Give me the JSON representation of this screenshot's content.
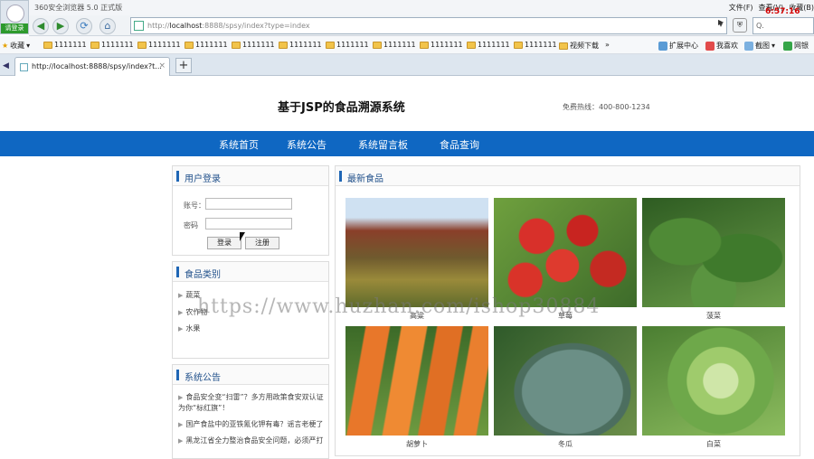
{
  "browser": {
    "window_title": "360安全浏览器 5.0 正式版",
    "menus": [
      "文件(F)",
      "查看(V)",
      "收藏(B)"
    ],
    "clock": "6:57:16",
    "avatar_label": "请登录",
    "address": {
      "prefix": "http://",
      "host": "localhost",
      "rest": ":8888/spsy/index?type=index"
    },
    "search_placeholder": "Q.",
    "bookmarks": {
      "favorites_label": "收藏",
      "folders": [
        "1111111",
        "1111111",
        "1111111",
        "1111111",
        "1111111",
        "1111111",
        "1111111",
        "1111111",
        "1111111",
        "1111111",
        "1111111",
        "1111111"
      ],
      "video_label": "视频下载",
      "more": "»",
      "extensions_label": "扩展中心",
      "myfav_label": "我喜欢",
      "screenshot_label": "截图",
      "netbank_label": "网银"
    },
    "tab": {
      "title": "http://localhost:8888/spsy/index?t...",
      "close": "×",
      "new_tab": "+"
    }
  },
  "site": {
    "title": "基于JSP的食品溯源系统",
    "hotline": "免费热线：400-800-1234",
    "nav": [
      "系统首页",
      "系统公告",
      "系统留言板",
      "食品查询"
    ]
  },
  "login": {
    "title": "用户登录",
    "account_label": "账号：",
    "password_label": "密码",
    "login_button": "登录",
    "register_button": "注册"
  },
  "categories": {
    "title": "食品类别",
    "items": [
      "蔬菜",
      "农作物",
      "水果"
    ]
  },
  "notices": {
    "title": "系统公告",
    "items": [
      "食品安全变“扫雷”？多方用政策食安双认证为你“标红旗”！",
      "国产食盐中的亚铁氰化钾有毒？谣言老梗了",
      "黑龙江省全力整治食品安全问题，必须严打"
    ]
  },
  "latest": {
    "title": "最新食品",
    "items": [
      "高粱",
      "草莓",
      "菠菜",
      "胡萝卜",
      "冬瓜",
      "白菜"
    ]
  },
  "watermark": "https://www.huzhan.com/ishop30884",
  "colors": {
    "nav_blue": "#0f67c2",
    "accent": "#1f66b5"
  }
}
